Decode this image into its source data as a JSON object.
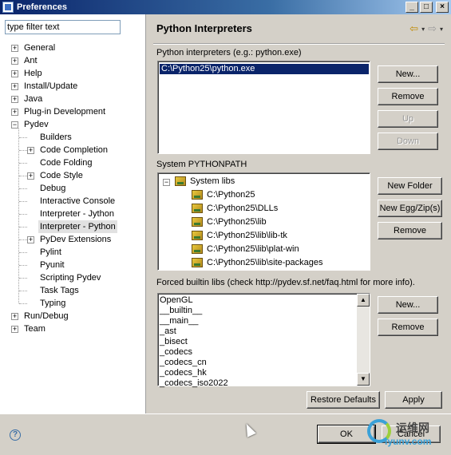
{
  "window": {
    "title": "Preferences",
    "controls": {
      "minimize": "_",
      "maximize": "□",
      "close": "×"
    }
  },
  "filter": {
    "value": "type filter text"
  },
  "tree": [
    {
      "label": "General",
      "level": 0,
      "expander": "+"
    },
    {
      "label": "Ant",
      "level": 0,
      "expander": "+"
    },
    {
      "label": "Help",
      "level": 0,
      "expander": "+"
    },
    {
      "label": "Install/Update",
      "level": 0,
      "expander": "+"
    },
    {
      "label": "Java",
      "level": 0,
      "expander": "+"
    },
    {
      "label": "Plug-in Development",
      "level": 0,
      "expander": "+"
    },
    {
      "label": "Pydev",
      "level": 0,
      "expander": "−"
    },
    {
      "label": "Builders",
      "level": 1,
      "expander": ""
    },
    {
      "label": "Code Completion",
      "level": 1,
      "expander": "+"
    },
    {
      "label": "Code Folding",
      "level": 1,
      "expander": ""
    },
    {
      "label": "Code Style",
      "level": 1,
      "expander": "+"
    },
    {
      "label": "Debug",
      "level": 1,
      "expander": ""
    },
    {
      "label": "Interactive Console",
      "level": 1,
      "expander": ""
    },
    {
      "label": "Interpreter - Jython",
      "level": 1,
      "expander": ""
    },
    {
      "label": "Interpreter - Python",
      "level": 1,
      "expander": "",
      "selected": true
    },
    {
      "label": "PyDev Extensions",
      "level": 1,
      "expander": "+"
    },
    {
      "label": "Pylint",
      "level": 1,
      "expander": ""
    },
    {
      "label": "Pyunit",
      "level": 1,
      "expander": ""
    },
    {
      "label": "Scripting Pydev",
      "level": 1,
      "expander": ""
    },
    {
      "label": "Task Tags",
      "level": 1,
      "expander": ""
    },
    {
      "label": "Typing",
      "level": 1,
      "expander": ""
    },
    {
      "label": "Run/Debug",
      "level": 0,
      "expander": "+"
    },
    {
      "label": "Team",
      "level": 0,
      "expander": "+"
    }
  ],
  "page": {
    "title": "Python Interpreters",
    "nav": {
      "back": "⇦",
      "forward": "⇨",
      "menu": "▾"
    }
  },
  "interpreters": {
    "label": "Python interpreters (e.g.: python.exe)",
    "items": [
      "C:\\Python25\\python.exe"
    ],
    "buttons": {
      "new": "New...",
      "remove": "Remove",
      "up": "Up",
      "down": "Down"
    }
  },
  "pythonpath": {
    "label": "System PYTHONPATH",
    "root": "System libs",
    "root_expander": "−",
    "items": [
      "C:\\Python25",
      "C:\\Python25\\DLLs",
      "C:\\Python25\\lib",
      "C:\\Python25\\lib\\lib-tk",
      "C:\\Python25\\lib\\plat-win",
      "C:\\Python25\\lib\\site-packages"
    ],
    "buttons": {
      "new_folder": "New Folder",
      "new_egg": "New Egg/Zip(s)",
      "remove": "Remove"
    }
  },
  "forced": {
    "label": "Forced builtin libs (check http://pydev.sf.net/faq.html for more info).",
    "items": [
      "OpenGL",
      "__builtin__",
      "__main__",
      "_ast",
      "_bisect",
      "_codecs",
      "_codecs_cn",
      "_codecs_hk",
      "_codecs_iso2022"
    ],
    "buttons": {
      "new": "New...",
      "remove": "Remove"
    },
    "scroll": {
      "up": "▲",
      "down": "▼"
    }
  },
  "footer": {
    "restore_defaults": "Restore Defaults",
    "apply": "Apply",
    "ok": "OK",
    "cancel": "Cancel",
    "help": "?"
  },
  "watermark": {
    "line1": "运维网",
    "line2": "iyunv.com"
  }
}
